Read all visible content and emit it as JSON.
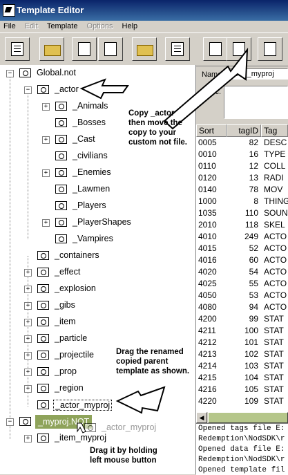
{
  "window": {
    "title": "Template Editor"
  },
  "menu": [
    {
      "label": "File",
      "enabled": true
    },
    {
      "label": "Edit",
      "enabled": false
    },
    {
      "label": "Template",
      "enabled": true
    },
    {
      "label": "Options",
      "enabled": false
    },
    {
      "label": "Help",
      "enabled": true
    }
  ],
  "toolbar": {
    "buttons": [
      "new-file-icon",
      "open-folder-icon",
      "save-template-icon",
      "save-all-icon",
      "close-file-icon",
      "list-icon",
      "move-template-icon",
      "copy-template-icon",
      "template-properties-icon"
    ]
  },
  "tree": {
    "root": "Global.not",
    "actor": "_actor",
    "actor_children": [
      "_Animals",
      "_Bosses",
      "_Cast",
      "_civilians",
      "_Enemies",
      "_Lawmen",
      "_Players",
      "_PlayerShapes",
      "_Vampires"
    ],
    "globals": [
      "_containers",
      "_effect",
      "_explosion",
      "_gibs",
      "_item",
      "_particle",
      "_projectile",
      "_prop",
      "_region",
      "_actor_myproj"
    ],
    "myproj_root": "_myproj.NOT",
    "myproj_children": [
      "_item_myproj"
    ],
    "drag_ghost": "_actor_myproj"
  },
  "details": {
    "name_label": "Name",
    "name_value": "_actor_myproj",
    "desc_label": "Desc."
  },
  "table": {
    "headers": [
      "Sort",
      "tagID",
      "Tag"
    ],
    "rows": [
      [
        "0005",
        "82",
        "DESC"
      ],
      [
        "0010",
        "16",
        "TYPE"
      ],
      [
        "0110",
        "12",
        "COLL"
      ],
      [
        "0120",
        "13",
        "RADI"
      ],
      [
        "0140",
        "78",
        "MOV"
      ],
      [
        "1000",
        "8",
        "THING"
      ],
      [
        "1035",
        "110",
        "SOUN"
      ],
      [
        "2010",
        "118",
        "SKEL"
      ],
      [
        "4010",
        "249",
        "ACTO"
      ],
      [
        "4015",
        "52",
        "ACTO"
      ],
      [
        "4016",
        "60",
        "ACTO"
      ],
      [
        "4020",
        "54",
        "ACTO"
      ],
      [
        "4025",
        "55",
        "ACTO"
      ],
      [
        "4050",
        "53",
        "ACTO"
      ],
      [
        "4080",
        "94",
        "ACTO"
      ],
      [
        "4200",
        "99",
        "STAT"
      ],
      [
        "4211",
        "100",
        "STAT"
      ],
      [
        "4212",
        "101",
        "STAT"
      ],
      [
        "4213",
        "102",
        "STAT"
      ],
      [
        "4214",
        "103",
        "STAT"
      ],
      [
        "4215",
        "104",
        "STAT"
      ],
      [
        "4216",
        "105",
        "STAT"
      ],
      [
        "4220",
        "109",
        "STAT"
      ]
    ]
  },
  "log": [
    "Opened tags file E:",
    "Redemption\\NodSDK\\r",
    "Opened data file E:",
    "Redemption\\NodSDK\\r",
    "Opened template fil"
  ],
  "annotations": {
    "copy_lines": [
      "Copy _actor",
      "then move the",
      "copy to your",
      "custom not file."
    ],
    "drag_lines": [
      "Drag the renamed",
      "copied parent",
      "template as shown."
    ],
    "hold_lines": [
      "Drag it by holding",
      "left mouse button"
    ]
  },
  "colors": {
    "selection": "#8ea35a",
    "title_bar": "#0a246a",
    "scroll_thumb": "#b5c68a"
  }
}
